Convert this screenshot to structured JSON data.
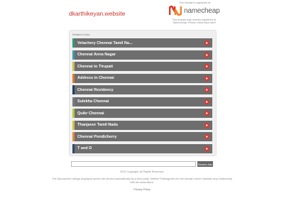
{
  "header": {
    "domain": "dkarthikeyan.website",
    "registered_note": "This domain is registered at",
    "registrar_name": "namecheap",
    "registrar_text": "This domain was recently registered at Namecheap. Please check back later!",
    "accent_color": "#de3723"
  },
  "panel": {
    "title": "Related Links",
    "links": [
      {
        "label": "Velachery Chennai Tamil Na...",
        "stripe": "#2d9d78",
        "arrow": "#e0362c"
      },
      {
        "label": "Chennai Anna Nagar",
        "stripe": "#3a9bb0",
        "arrow": "#e0362c"
      },
      {
        "label": "Chennai to Tirupati",
        "stripe": "#c8c04a",
        "arrow": "#e0362c"
      },
      {
        "label": "Address in Chennai",
        "stripe": "#e07a24",
        "arrow": "#e0362c"
      },
      {
        "label": "Chennai Residency",
        "stripe": "#1f3f66",
        "arrow": "#e0362c"
      },
      {
        "label": "Sulekha Chennai",
        "stripe": "#7a7a7a",
        "arrow": "#e0362c"
      },
      {
        "label": "Quikr Chennai",
        "stripe": "#b8c83a",
        "arrow": "#e0362c"
      },
      {
        "label": "Thanjavur Tamil Nadu",
        "stripe": "#d6c23c",
        "arrow": "#e0362c"
      },
      {
        "label": "Chennai Pondicherry",
        "stripe": "#e08a3a",
        "arrow": "#e0362c"
      },
      {
        "label": "T and D",
        "stripe": "#2a4a70",
        "arrow": "#e0362c"
      }
    ]
  },
  "search": {
    "placeholder": "",
    "button_label": "Search Ads"
  },
  "footer": {
    "copyright": "2023 Copyright. All Rights Reserved.",
    "disclaimer": "The Sponsored Listings displayed above are served automatically by a third party. Neither Parkingcrew nor the domain owner maintain any relationship with the advertisers.",
    "privacy_label": "Privacy Policy"
  }
}
